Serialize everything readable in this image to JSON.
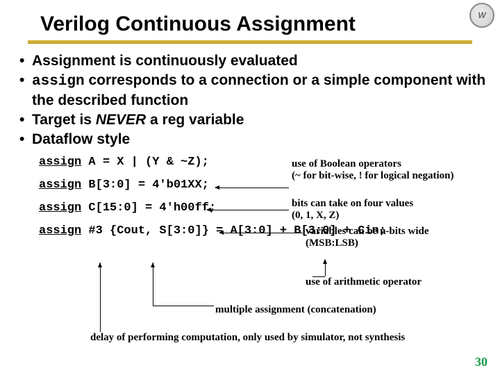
{
  "title": "Verilog Continuous Assignment",
  "logo_glyph": "W",
  "bullets": [
    {
      "pre": "",
      "code": "",
      "post": "Assignment is continuously evaluated"
    },
    {
      "pre": "",
      "code": "assign",
      "post": " corresponds to a connection or a simple component with the described function"
    },
    {
      "pre": "Target is ",
      "emph": "NEVER",
      "post": " a reg variable"
    },
    {
      "pre": "",
      "code": "",
      "post": "Dataflow style"
    }
  ],
  "code": {
    "l1_kw": "assign",
    "l1_rest": " A = X | (Y & ~Z);",
    "l2_kw": "assign",
    "l2_rest": " B[3:0] = 4'b01XX;",
    "l3_kw": "assign",
    "l3_rest": " C[15:0] = 4'h00ff;",
    "l4_kw": "assign",
    "l4_rest": " #3 {Cout, S[3:0]} = A[3:0] + B[3:0] + Cin;"
  },
  "annots": {
    "a1_l1": "use of Boolean operators",
    "a1_l2": "(~ for bit-wise, ! for logical negation)",
    "a2_l1": "bits can take on four values",
    "a2_l2": "(0, 1, X, Z)",
    "a3_l1": "variables can be n-bits wide",
    "a3_l2": "(MSB:LSB)",
    "a4": "use of arithmetic operator",
    "a5": "multiple assignment (concatenation)",
    "a6": "delay of performing computation, only used by simulator, not synthesis"
  },
  "page_number": "30"
}
